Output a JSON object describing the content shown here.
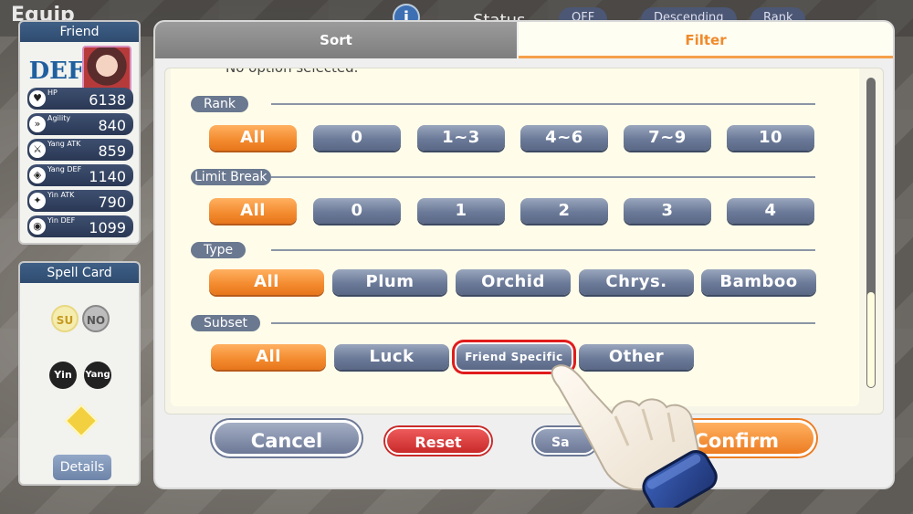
{
  "background": {
    "title": "Equip",
    "status_label": "Status",
    "toggle_label": "OFF",
    "order_label": "Descending",
    "rank_label": "Rank"
  },
  "friend_panel": {
    "header": "Friend",
    "badge": "DEF",
    "stats": [
      {
        "name": "HP",
        "value": "6138"
      },
      {
        "name": "Agility",
        "value": "840"
      },
      {
        "name": "Yang ATK",
        "value": "859"
      },
      {
        "name": "Yang DEF",
        "value": "1140"
      },
      {
        "name": "Yin ATK",
        "value": "790"
      },
      {
        "name": "Yin DEF",
        "value": "1099"
      }
    ]
  },
  "spell_panel": {
    "header": "Spell Card",
    "tags": [
      "SU",
      "NO",
      "Yin",
      "Yang"
    ],
    "details_label": "Details"
  },
  "modal": {
    "tabs": {
      "sort": "Sort",
      "filter": "Filter"
    },
    "cut_text": "No option selected.",
    "sections": {
      "rank": {
        "label": "Rank",
        "options": [
          "All",
          "0",
          "1~3",
          "4~6",
          "7~9",
          "10"
        ]
      },
      "limit_break": {
        "label": "Limit Break",
        "options": [
          "All",
          "0",
          "1",
          "2",
          "3",
          "4"
        ]
      },
      "type": {
        "label": "Type",
        "options": [
          "All",
          "Plum",
          "Orchid",
          "Chrys.",
          "Bamboo"
        ]
      },
      "subset": {
        "label": "Subset",
        "options": [
          "All",
          "Luck",
          "Friend Specific",
          "Other"
        ]
      }
    },
    "footer": {
      "cancel": "Cancel",
      "reset": "Reset",
      "save": "Sa",
      "confirm": "Confirm"
    }
  },
  "colors": {
    "selected": "#f38a2e",
    "unselected": "#6b7a98",
    "highlight_ring": "#e01c1c"
  }
}
